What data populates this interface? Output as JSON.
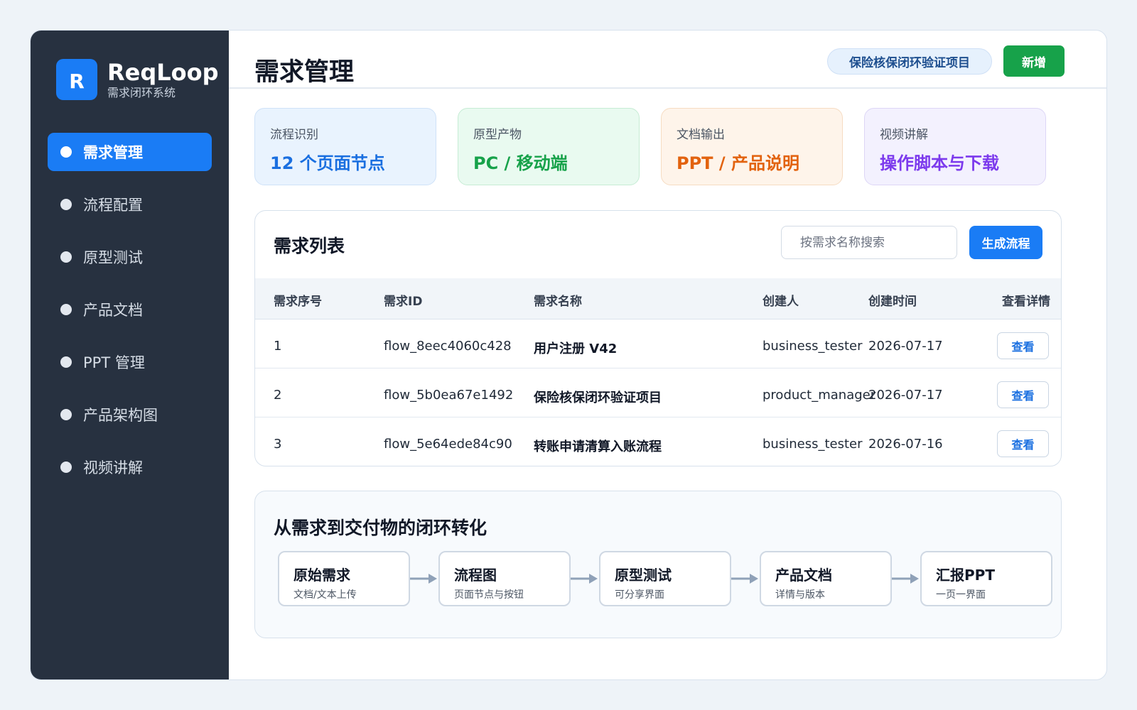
{
  "brand": {
    "logo_letter": "R",
    "name": "ReqLoop",
    "subtitle": "需求闭环系统"
  },
  "sidebar": {
    "items": [
      {
        "label": "需求管理",
        "active": true
      },
      {
        "label": "流程配置",
        "active": false
      },
      {
        "label": "原型测试",
        "active": false
      },
      {
        "label": "产品文档",
        "active": false
      },
      {
        "label": "PPT 管理",
        "active": false
      },
      {
        "label": "产品架构图",
        "active": false
      },
      {
        "label": "视频讲解",
        "active": false
      }
    ]
  },
  "header": {
    "title": "需求管理",
    "project_chip": "保险核保闭环验证项目",
    "add_label": "新增"
  },
  "stats": [
    {
      "label": "流程识别",
      "value": "12 个页面节点",
      "color": "#1a6fe0",
      "bg": "#e9f3fe",
      "border": "#cfe2f8"
    },
    {
      "label": "原型产物",
      "value": "PC / 移动端",
      "color": "#17a24a",
      "bg": "#e9faf0",
      "border": "#c6ecd4"
    },
    {
      "label": "文档输出",
      "value": "PPT / 产品说明",
      "color": "#e2620e",
      "bg": "#fef4ea",
      "border": "#f6dcc2"
    },
    {
      "label": "视频讲解",
      "value": "操作脚本与下载",
      "color": "#7c3aed",
      "bg": "#f3f1fe",
      "border": "#ddd6f6"
    }
  ],
  "requirements": {
    "title": "需求列表",
    "search_placeholder": "按需求名称搜索",
    "generate_label": "生成流程",
    "columns": [
      "需求序号",
      "需求ID",
      "需求名称",
      "创建人",
      "创建时间",
      "查看详情"
    ],
    "rows": [
      {
        "index": "1",
        "id": "flow_8eec4060c428",
        "name": "用户注册 V42",
        "creator": "business_tester",
        "created": "2026-07-17",
        "action": "查看"
      },
      {
        "index": "2",
        "id": "flow_5b0ea67e1492",
        "name": "保险核保闭环验证项目",
        "creator": "product_manager",
        "created": "2026-07-17",
        "action": "查看"
      },
      {
        "index": "3",
        "id": "flow_5e64ede84c90",
        "name": "转账申请清算入账流程",
        "creator": "business_tester",
        "created": "2026-07-16",
        "action": "查看"
      }
    ]
  },
  "pipeline": {
    "title": "从需求到交付物的闭环转化",
    "steps": [
      {
        "title": "原始需求",
        "sub": "文档/文本上传"
      },
      {
        "title": "流程图",
        "sub": "页面节点与按钮"
      },
      {
        "title": "原型测试",
        "sub": "可分享界面"
      },
      {
        "title": "产品文档",
        "sub": "详情与版本"
      },
      {
        "title": "汇报PPT",
        "sub": "一页一界面"
      }
    ]
  }
}
